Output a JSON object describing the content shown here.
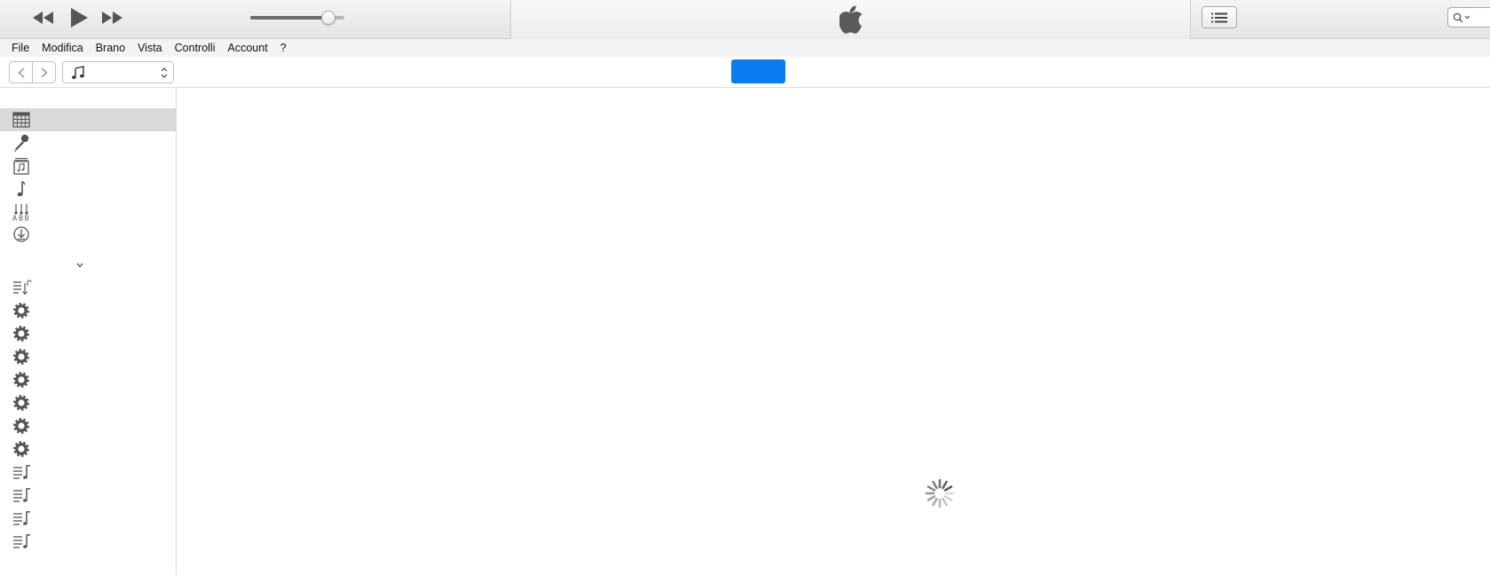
{
  "window": {
    "app_logo": "apple-icon",
    "accent_color": "#0a7cf3"
  },
  "player": {
    "rewind_icon": "rewind-icon",
    "play_icon": "play-icon",
    "forward_icon": "fast-forward-icon",
    "volume_level": 0.83,
    "list_icon": "list-icon",
    "search_icon": "search-icon",
    "search_value": ""
  },
  "menu": {
    "items": [
      "File",
      "Modifica",
      "Brano",
      "Vista",
      "Controlli",
      "Account",
      "?"
    ]
  },
  "navbar": {
    "back_icon": "chevron-left-icon",
    "forward_icon": "chevron-right-icon",
    "media_icon": "music-note-icon",
    "media_value": "",
    "center_button_label": ""
  },
  "sidebar": {
    "library_items": [
      {
        "icon": "grid-icon",
        "label": "",
        "selected": true
      },
      {
        "icon": "microphone-icon",
        "label": ""
      },
      {
        "icon": "album-icon",
        "label": ""
      },
      {
        "icon": "music-note-icon",
        "label": ""
      },
      {
        "icon": "genres-icon",
        "label": ""
      },
      {
        "icon": "download-icon",
        "label": ""
      }
    ],
    "collapse_icon": "chevron-down-icon",
    "playlist_items": [
      {
        "icon": "playlist-download-icon",
        "label": ""
      },
      {
        "icon": "smart-playlist-gear-icon",
        "label": ""
      },
      {
        "icon": "smart-playlist-gear-icon",
        "label": ""
      },
      {
        "icon": "smart-playlist-gear-icon",
        "label": ""
      },
      {
        "icon": "smart-playlist-gear-icon",
        "label": ""
      },
      {
        "icon": "smart-playlist-gear-icon",
        "label": ""
      },
      {
        "icon": "smart-playlist-gear-icon",
        "label": ""
      },
      {
        "icon": "smart-playlist-gear-icon",
        "label": ""
      },
      {
        "icon": "playlist-icon",
        "label": ""
      },
      {
        "icon": "playlist-icon",
        "label": ""
      },
      {
        "icon": "playlist-icon",
        "label": ""
      },
      {
        "icon": "playlist-icon",
        "label": ""
      }
    ]
  },
  "main": {
    "status_icon": "loading-spinner-icon"
  }
}
